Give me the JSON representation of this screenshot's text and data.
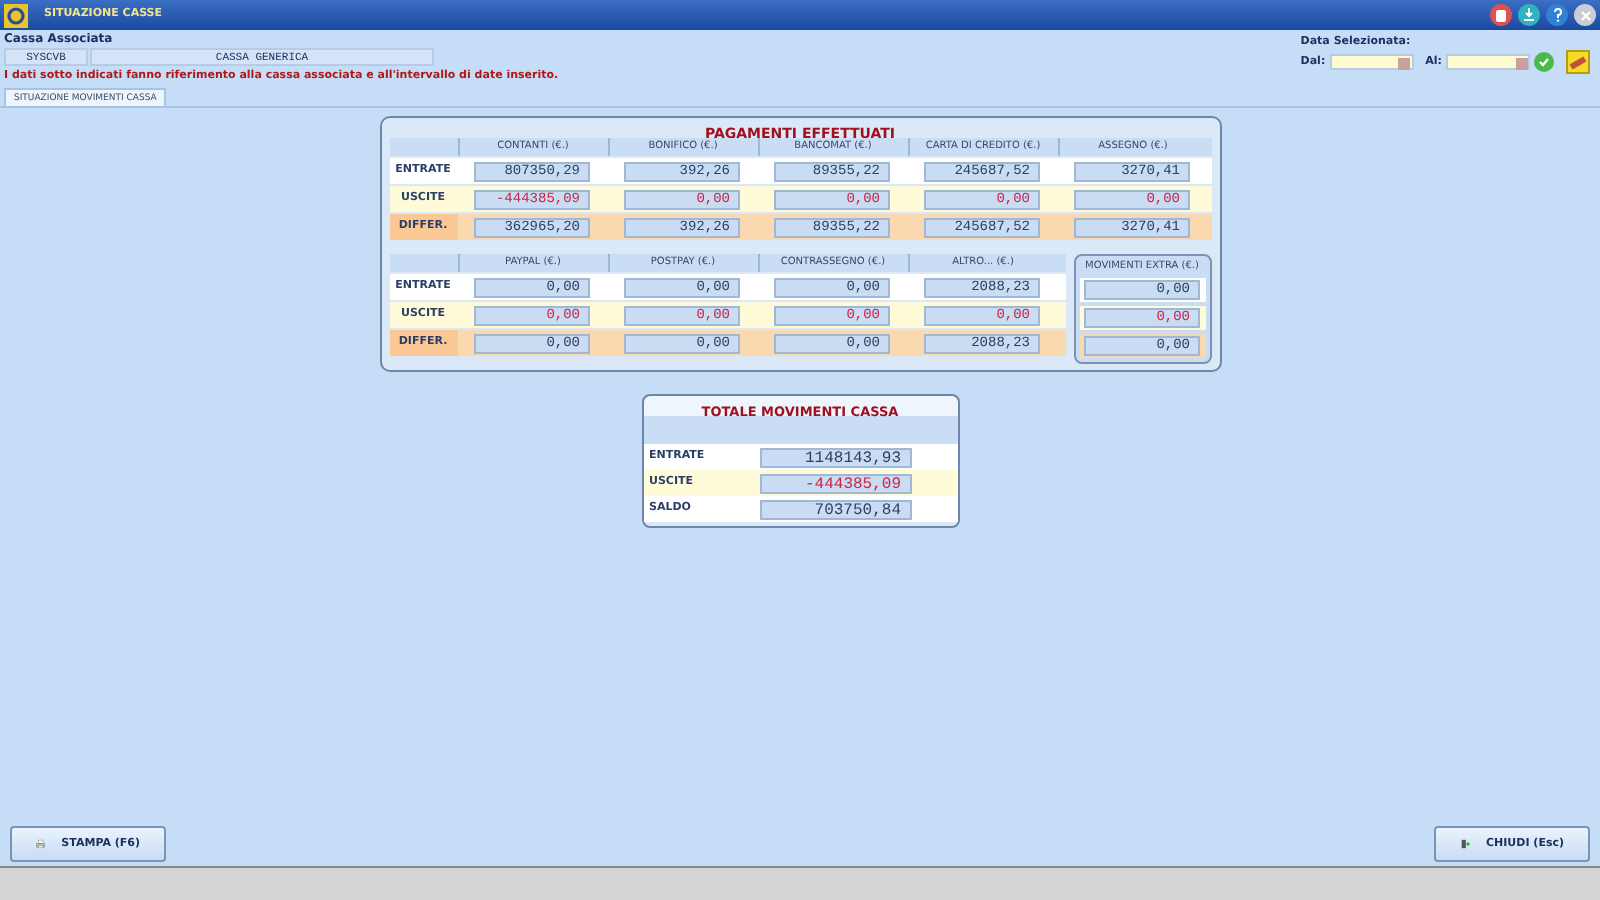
{
  "window": {
    "title": "SITUAZIONE CASSE"
  },
  "header": {
    "label": "Cassa Associata",
    "code": "SYSCVB",
    "name": "CASSA GENERICA",
    "notice": "I dati sotto indicati fanno riferimento alla cassa associata e all'intervallo di date inserito."
  },
  "date_filter": {
    "label": "Data Selezionata:",
    "from_label": "Dal:",
    "to_label": "Al:"
  },
  "tabs": [
    {
      "label": "SITUAZIONE MOVIMENTI CASSA",
      "selected": true
    }
  ],
  "payments": {
    "title": "PAGAMENTI EFFETTUATI",
    "sections": [
      {
        "columns": [
          "CONTANTI (€.)",
          "BONIFICO (€.)",
          "BANCOMAT (€.)",
          "CARTA DI CREDITO (€.)",
          "ASSEGNO (€.)"
        ],
        "rows": [
          {
            "label": "ENTRATE",
            "kind": "in",
            "values": [
              "807350,29",
              "392,26",
              "89355,22",
              "245687,52",
              "3270,41"
            ]
          },
          {
            "label": "USCITE",
            "kind": "out",
            "values": [
              "-444385,09",
              "0,00",
              "0,00",
              "0,00",
              "0,00"
            ]
          },
          {
            "label": "DIFFER.",
            "kind": "diff",
            "values": [
              "362965,20",
              "392,26",
              "89355,22",
              "245687,52",
              "3270,41"
            ]
          }
        ]
      },
      {
        "columns": [
          "PAYPAL (€.)",
          "POSTPAY (€.)",
          "CONTRASSEGNO (€.)",
          "ALTRO... (€.)"
        ],
        "rows": [
          {
            "label": "ENTRATE",
            "kind": "in",
            "values": [
              "0,00",
              "0,00",
              "0,00",
              "2088,23"
            ]
          },
          {
            "label": "USCITE",
            "kind": "out",
            "values": [
              "0,00",
              "0,00",
              "0,00",
              "0,00"
            ]
          },
          {
            "label": "DIFFER.",
            "kind": "diff",
            "values": [
              "0,00",
              "0,00",
              "0,00",
              "2088,23"
            ]
          }
        ],
        "extra": {
          "header": "MOVIMENTI EXTRA (€.)",
          "values": [
            "0,00",
            "0,00",
            "0,00"
          ]
        }
      }
    ]
  },
  "totals": {
    "title": "TOTALE MOVIMENTI CASSA",
    "rows": [
      {
        "label": "ENTRATE",
        "kind": "in",
        "value": "1148143,93"
      },
      {
        "label": "USCITE",
        "kind": "out",
        "value": "-444385,09"
      },
      {
        "label": "SALDO",
        "kind": "balance",
        "value": "703750,84"
      }
    ]
  },
  "buttons": [
    {
      "label": "STAMPA (F6)",
      "kind": "print"
    },
    {
      "label": "CHIUDI  (Esc)",
      "kind": "close"
    }
  ]
}
